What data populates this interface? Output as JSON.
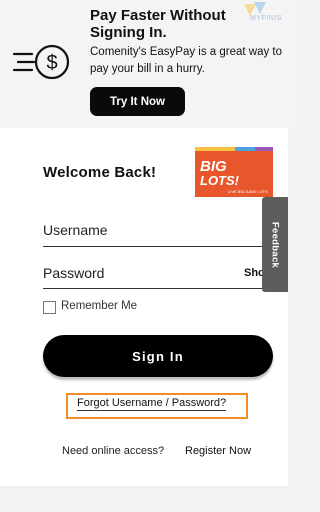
{
  "promo": {
    "title": "Pay Faster Without Signing In.",
    "text": "Comenity's EasyPay is a great way to pay your bill in a hurry.",
    "button_label": "Try It Now",
    "icon": "fast-dollar-icon",
    "watermark": "MYFINIS"
  },
  "login": {
    "welcome": "Welcome Back!",
    "logo_text": "BIG LOTS!",
    "logo_tagline": "LIVE BIG SAVE LOTS",
    "username_label": "Username",
    "password_label": "Password",
    "show_label": "Sho",
    "remember_label": "Remember Me",
    "signin_label": "Sign In",
    "forgot_label": "Forgot Username / Password?",
    "access_text": "Need online access?",
    "register_label": "Register Now"
  },
  "feedback": {
    "label": "Feedback"
  },
  "colors": {
    "accent_highlight": "#f28c28",
    "logo_orange": "#e8572c",
    "button_black": "#000000"
  }
}
